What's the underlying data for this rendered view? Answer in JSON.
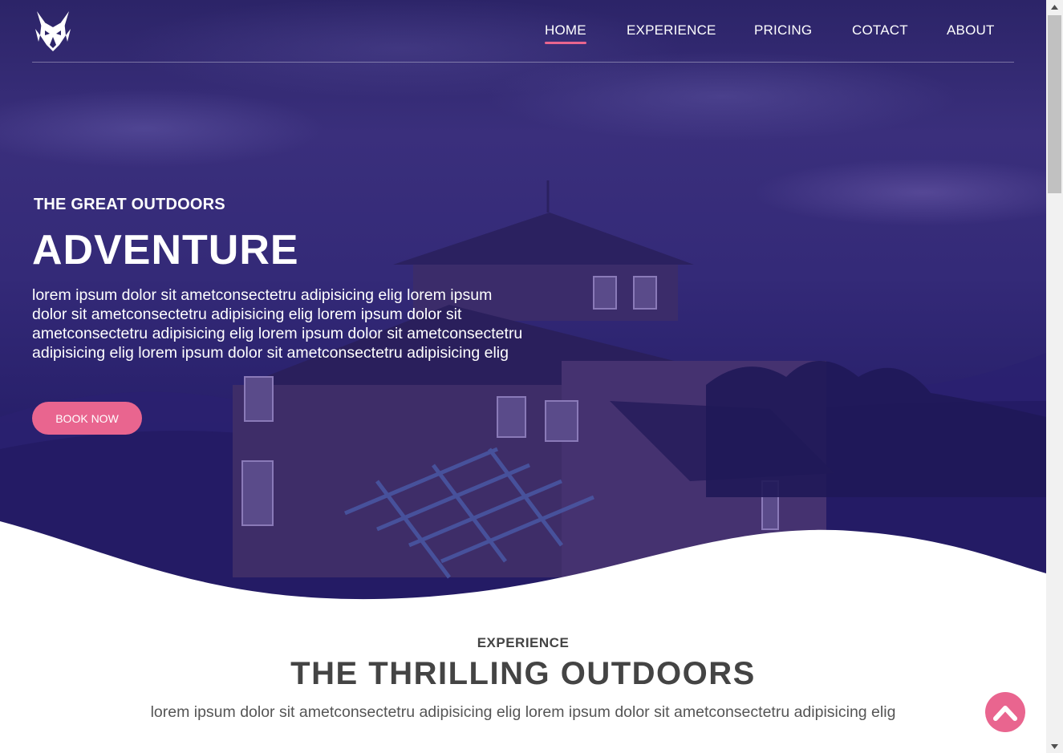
{
  "nav": {
    "logo": "wolf-logo",
    "items": [
      {
        "label": "HOME",
        "active": true
      },
      {
        "label": "EXPERIENCE",
        "active": false
      },
      {
        "label": "PRICING",
        "active": false
      },
      {
        "label": "COTACT",
        "active": false
      },
      {
        "label": "ABOUT",
        "active": false
      }
    ]
  },
  "hero": {
    "eyebrow": "THE GREAT OUTDOORS",
    "title": "ADVENTURE",
    "body": "lorem ipsum dolor sit ametconsectetru adipisicing elig lorem ipsum dolor sit ametconsectetru adipisicing elig lorem ipsum dolor sit ametconsectetru adipisicing elig lorem ipsum dolor sit ametconsectetru adipisicing elig lorem ipsum dolor sit ametconsectetru adipisicing elig",
    "cta": "BOOK NOW"
  },
  "section": {
    "eyebrow": "EXPERIENCE",
    "title": "THE THRILLING OUTDOORS",
    "body": "lorem ipsum dolor sit ametconsectetru adipisicing elig lorem ipsum dolor sit ametconsectetru adipisicing elig"
  },
  "colors": {
    "accent": "#e9658f",
    "hero_overlay": "#2c2468",
    "heading_text": "#444444"
  },
  "icons": {
    "scroll_top": "chevron-up-icon"
  }
}
